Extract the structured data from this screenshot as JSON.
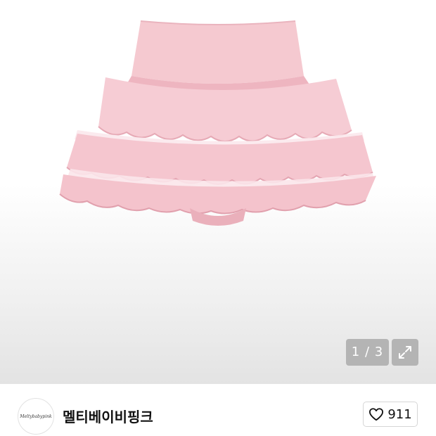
{
  "gallery": {
    "counter_text": "1 / 3",
    "current_image": 1,
    "total_images": 3,
    "expand_icon": "expand-arrows-icon",
    "product_colors": {
      "skirt_main": "#f4c6ce",
      "skirt_shadow": "#e9aab7",
      "lace": "#fbe6ea"
    }
  },
  "store": {
    "logo_text": "Meltybabypink",
    "name": "멜티베이비핑크",
    "like_icon": "heart-outline-icon",
    "like_count": "911"
  }
}
